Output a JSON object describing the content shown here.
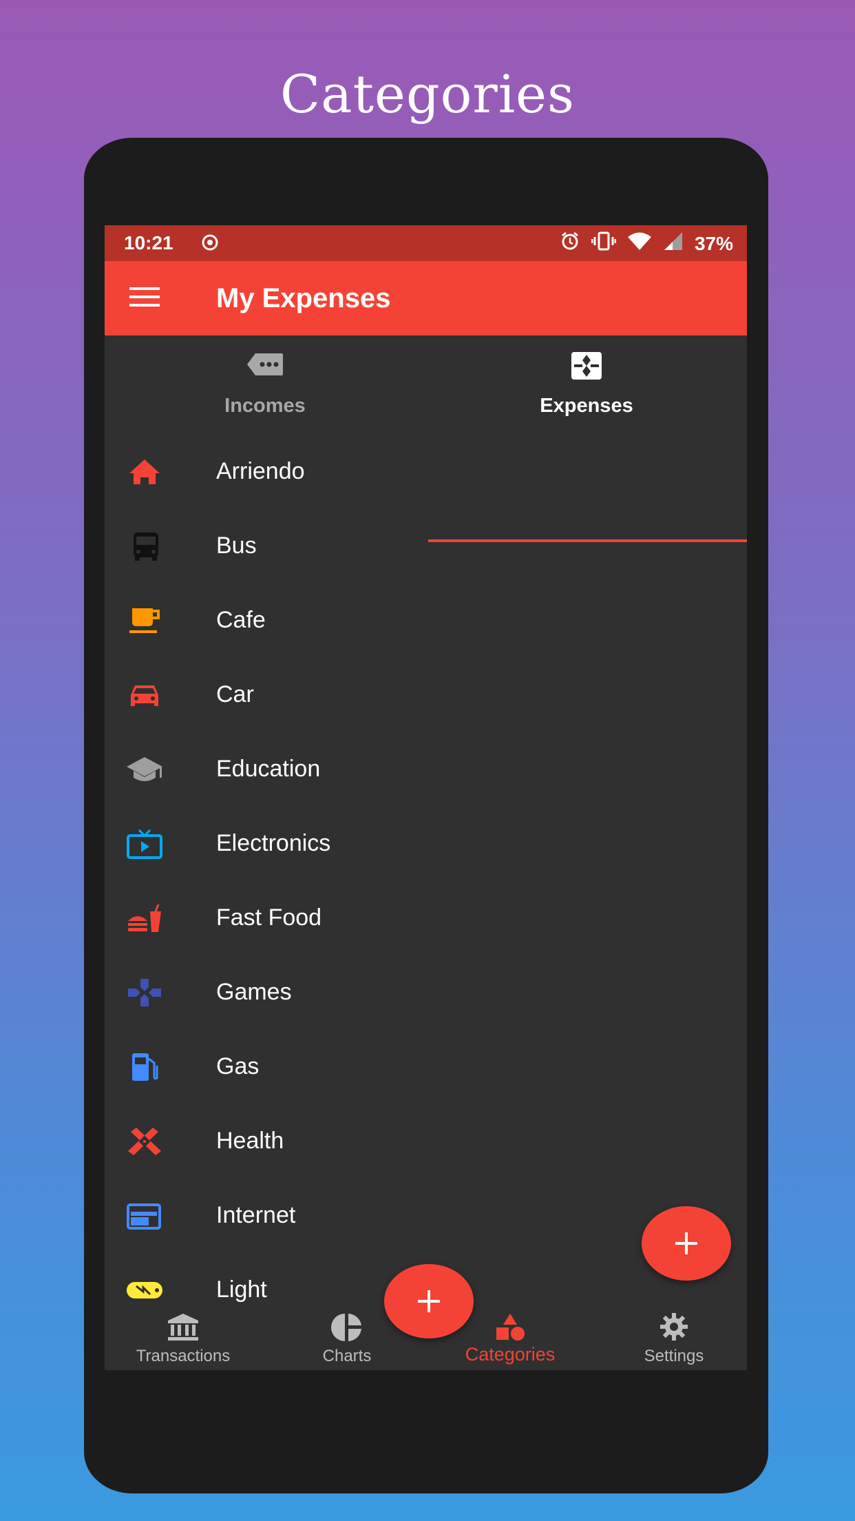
{
  "page": {
    "headline": "Categories"
  },
  "status_bar": {
    "time": "10:21",
    "battery": "37%"
  },
  "app_bar": {
    "title": "My Expenses"
  },
  "tabs": [
    {
      "label": "Incomes",
      "icon": "label-icon",
      "selected": false
    },
    {
      "label": "Expenses",
      "icon": "expenses-icon",
      "selected": true
    }
  ],
  "categories": [
    {
      "label": "Arriendo",
      "icon": "home-icon",
      "color": "#f44336"
    },
    {
      "label": "Bus",
      "icon": "bus-icon",
      "color": "#111111"
    },
    {
      "label": "Cafe",
      "icon": "cafe-icon",
      "color": "#ff9800"
    },
    {
      "label": "Car",
      "icon": "car-icon",
      "color": "#f44336"
    },
    {
      "label": "Education",
      "icon": "school-icon",
      "color": "#9e9e9e"
    },
    {
      "label": "Electronics",
      "icon": "tv-icon",
      "color": "#03a9f4"
    },
    {
      "label": "Fast Food",
      "icon": "fastfood-icon",
      "color": "#f44336"
    },
    {
      "label": "Games",
      "icon": "gamepad-icon",
      "color": "#3f51b5"
    },
    {
      "label": "Gas",
      "icon": "gas-station-icon",
      "color": "#448aff"
    },
    {
      "label": "Health",
      "icon": "healing-icon",
      "color": "#f44336"
    },
    {
      "label": "Internet",
      "icon": "web-icon",
      "color": "#448aff"
    },
    {
      "label": "Light",
      "icon": "power-icon",
      "color": "#ffeb3b"
    }
  ],
  "bottom_nav": [
    {
      "label": "Transactions",
      "icon": "bank-icon",
      "active": false
    },
    {
      "label": "Charts",
      "icon": "pie-chart-icon",
      "active": false
    },
    {
      "label": "Categories",
      "icon": "category-icon",
      "active": true
    },
    {
      "label": "Settings",
      "icon": "gear-icon",
      "active": false
    }
  ],
  "colors": {
    "accent": "#f44336",
    "status_bar": "#b63127",
    "background": "#303030"
  }
}
